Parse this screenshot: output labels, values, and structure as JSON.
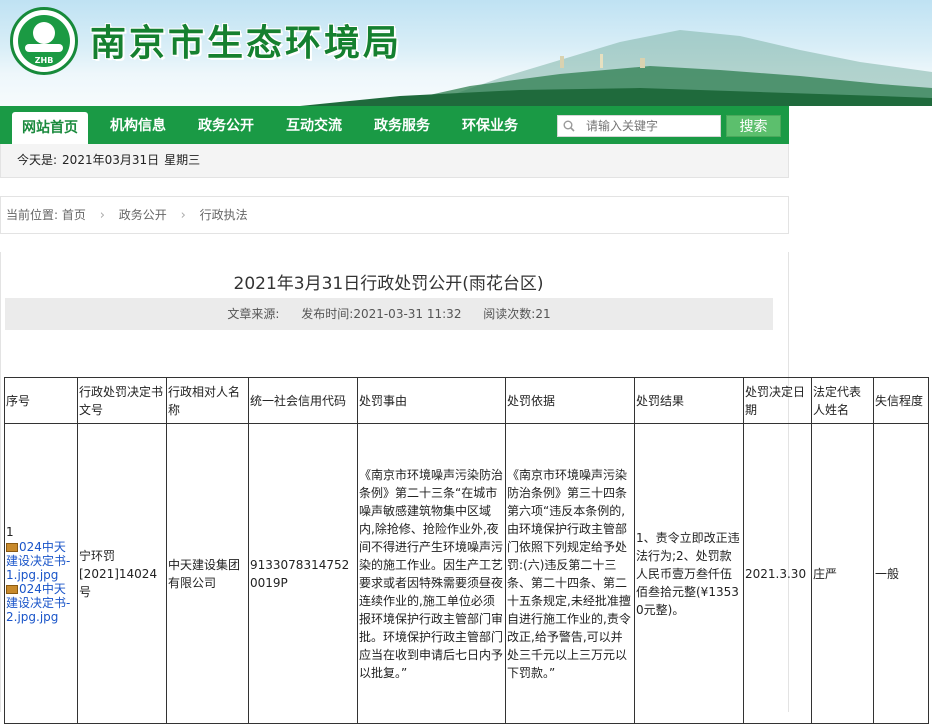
{
  "site": {
    "title": "南京市生态环境局",
    "logo_text": "ZHB"
  },
  "nav": {
    "items": [
      {
        "label": "网站首页",
        "active": true
      },
      {
        "label": "机构信息"
      },
      {
        "label": "政务公开"
      },
      {
        "label": "互动交流"
      },
      {
        "label": "政务服务"
      },
      {
        "label": "环保业务"
      }
    ],
    "search_placeholder": "请输入关键字",
    "search_button": "搜索"
  },
  "dateline": {
    "prefix": "今天是:",
    "date": "2021年03月31日",
    "weekday": "星期三"
  },
  "breadcrumb": {
    "prefix": "当前位置:",
    "items": [
      "首页",
      "政务公开",
      "行政执法"
    ]
  },
  "article": {
    "title": "2021年3月31日行政处罚公开(雨花台区)",
    "source_label": "文章来源:",
    "publish_label": "发布时间:",
    "publish_time": "2021-03-31 11:32",
    "views_label": "阅读次数:",
    "views": "21"
  },
  "table": {
    "headers": [
      "序号",
      "行政处罚决定书文号",
      "行政相对人名称",
      "统一社会信用代码",
      "处罚事由",
      "处罚依据",
      "处罚结果",
      "处罚决定日期",
      "法定代表人姓名",
      "失信程度"
    ],
    "row": {
      "index": "1",
      "attachments": [
        "024中天建设决定书-1.jpg.jpg",
        "024中天建设决定书-2.jpg.jpg"
      ],
      "doc_no_line1": "宁环罚",
      "doc_no_line2": "[2021]14024号",
      "party": "中天建设集团有限公司",
      "credit_code": "91330783147520019P",
      "reason": "《南京市环境噪声污染防治条例》第二十三条“在城市噪声敏感建筑物集中区域内,除抢修、抢险作业外,夜间不得进行产生环境噪声污染的施工作业。因生产工艺要求或者因特殊需要须昼夜连续作业的,施工单位必须报环境保护行政主管部门审批。环境保护行政主管部门应当在收到申请后七日内予以批复。”",
      "basis": "《南京市环境噪声污染防治条例》第三十四条第六项“违反本条例的,由环境保护行政主管部门依照下列规定给予处罚:(六)违反第二十三条、第二十四条、第二十五条规定,未经批准擅自进行施工作业的,责令改正,给予警告,可以并处三千元以上三万元以下罚款。”",
      "result": "1、责令立即改正违法行为;2、处罚款人民币壹万叁仟伍佰叁拾元整(¥13530元整)。",
      "date": "2021.3.30",
      "legal_rep": "庄严",
      "credit_level": "一般"
    }
  },
  "colors": {
    "nav_green": "#1a9a45",
    "title_green": "#15802f",
    "link_blue": "#1a55c9",
    "search_button": "#5cbf6d"
  }
}
